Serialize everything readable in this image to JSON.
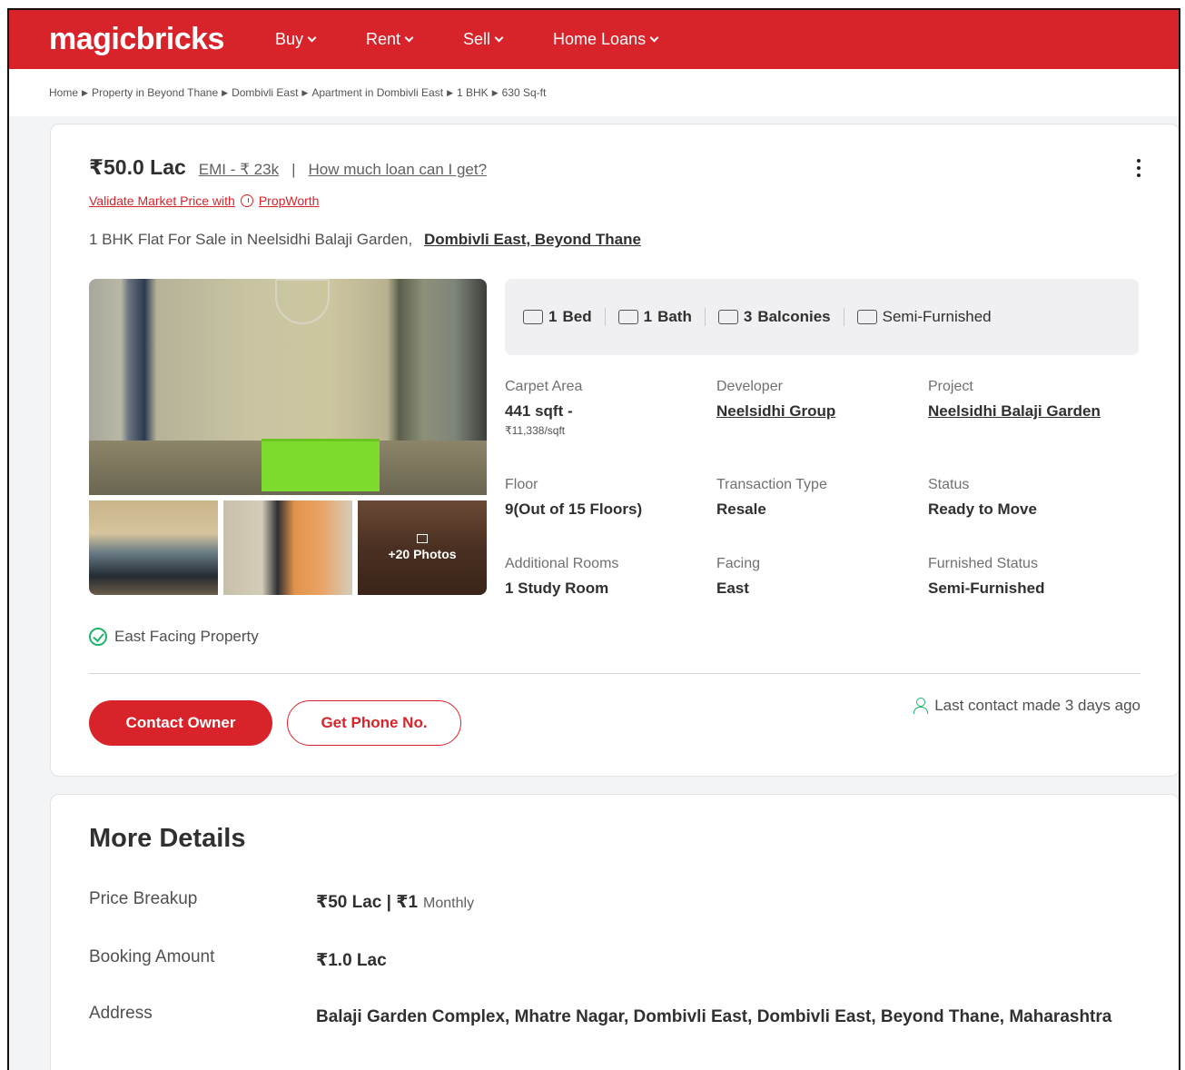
{
  "header": {
    "logo": "magicbricks",
    "nav": [
      "Buy",
      "Rent",
      "Sell",
      "Home Loans"
    ]
  },
  "breadcrumb": [
    "Home",
    "Property in Beyond Thane",
    "Dombivli East",
    "Apartment in Dombivli East",
    "1 BHK",
    "630 Sq-ft"
  ],
  "listing": {
    "price": "₹50.0 Lac",
    "emi": "EMI - ₹ 23k",
    "separator": "|",
    "loan_link": "How much loan can I get?",
    "validate_prefix": "Validate Market Price with",
    "validate_link": "PropWorth",
    "title": "1 BHK Flat For Sale in Neelsidhi Balaji Garden,",
    "location": "Dombivli East, Beyond Thane",
    "photos_label": "+20 Photos",
    "summary": [
      {
        "value": "1",
        "label": "Bed",
        "icon": "bed-icon"
      },
      {
        "value": "1",
        "label": "Bath",
        "icon": "bath-icon"
      },
      {
        "value": "3",
        "label": "Balconies",
        "icon": "balcony-icon"
      },
      {
        "value": "",
        "label": "Semi-Furnished",
        "icon": "furnishing-icon"
      }
    ],
    "details": {
      "carpet_area_label": "Carpet Area",
      "carpet_area_value": "441 sqft -",
      "carpet_area_rate": "₹11,338/sqft",
      "developer_label": "Developer",
      "developer_value": "Neelsidhi Group",
      "project_label": "Project",
      "project_value": "Neelsidhi Balaji Garden",
      "floor_label": "Floor",
      "floor_value": "9(Out of 15 Floors)",
      "transaction_label": "Transaction Type",
      "transaction_value": "Resale",
      "status_label": "Status",
      "status_value": "Ready to Move",
      "rooms_label": "Additional Rooms",
      "rooms_value": "1 Study Room",
      "facing_label": "Facing",
      "facing_value": "East",
      "furnished_label": "Furnished Status",
      "furnished_value": "Semi-Furnished"
    },
    "tag": "East Facing Property",
    "contact_button": "Contact Owner",
    "phone_button": "Get Phone No.",
    "last_contact": "Last contact made 3 days ago"
  },
  "more_details": {
    "title": "More Details",
    "price_breakup_label": "Price Breakup",
    "price_breakup_value": "₹50 Lac | ₹1",
    "price_breakup_suffix": "Monthly",
    "booking_label": "Booking Amount",
    "booking_value": "₹1.0 Lac",
    "address_label": "Address",
    "address_value": "Balaji Garden Complex, Mhatre Nagar, Dombivli East, Dombivli East, Beyond Thane, Maharashtra"
  },
  "colors": {
    "brand": "#d8232a",
    "success": "#1fb36b"
  }
}
